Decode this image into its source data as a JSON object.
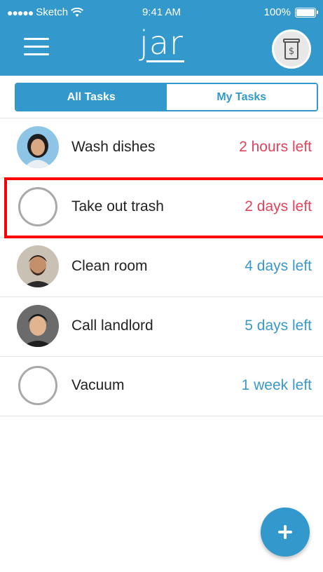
{
  "status_bar": {
    "carrier": "Sketch",
    "time": "9:41 AM",
    "battery": "100%"
  },
  "header": {
    "logo": "jar",
    "menu_icon": "hamburger-menu-icon",
    "jar_icon": "money-jar-icon",
    "accent_color": "#3399cc"
  },
  "tabs": [
    {
      "label": "All Tasks",
      "selected": true
    },
    {
      "label": "My Tasks",
      "selected": false
    }
  ],
  "tasks": [
    {
      "name": "Wash dishes",
      "due": "2 hours left",
      "assignee": "avatar-woman",
      "urgent": true
    },
    {
      "name": "Take out trash",
      "due": "2 days left",
      "assignee": "unassigned",
      "urgent": true
    },
    {
      "name": "Clean room",
      "due": "4 days left",
      "assignee": "avatar-man-beard",
      "urgent": false
    },
    {
      "name": "Call landlord",
      "due": "5 days left",
      "assignee": "avatar-man",
      "urgent": false
    },
    {
      "name": "Vacuum",
      "due": "1 week left",
      "assignee": "unassigned",
      "urgent": false
    }
  ],
  "fab": {
    "icon": "plus-icon"
  },
  "colors": {
    "urgent": "#e0435c",
    "normal": "#3b98c8"
  }
}
